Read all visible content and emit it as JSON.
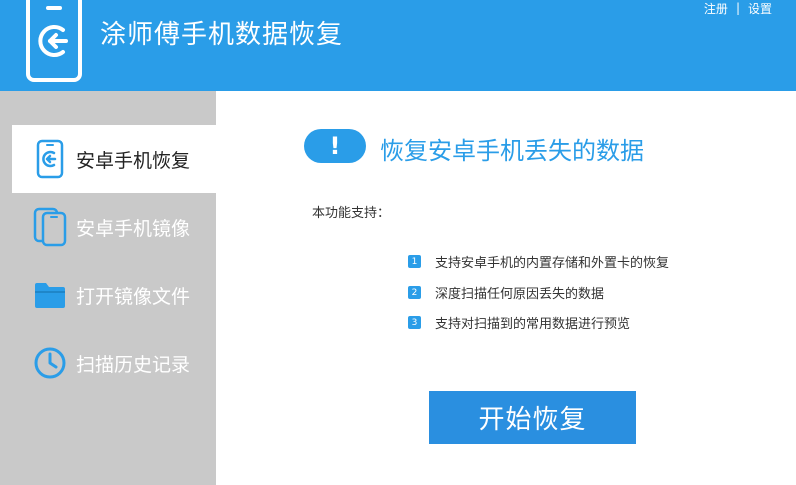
{
  "app": {
    "title": "涂师傅手机数据恢复"
  },
  "top_links": {
    "register": "注册",
    "separator": "|",
    "settings": "设置"
  },
  "sidebar": {
    "items": [
      {
        "label": "安卓手机恢复",
        "icon": "phone-restore-icon",
        "active": true
      },
      {
        "label": "安卓手机镜像",
        "icon": "phone-mirror-icon",
        "active": false
      },
      {
        "label": "打开镜像文件",
        "icon": "folder-icon",
        "active": false
      },
      {
        "label": "扫描历史记录",
        "icon": "clock-icon",
        "active": false
      }
    ]
  },
  "main": {
    "heading_icon": "!",
    "heading": "恢复安卓手机丢失的数据",
    "support_label": "本功能支持：",
    "features": [
      {
        "num": "1",
        "text": "支持安卓手机的内置存储和外置卡的恢复"
      },
      {
        "num": "2",
        "text": "深度扫描任何原因丢失的数据"
      },
      {
        "num": "3",
        "text": "支持对扫描到的常用数据进行预览"
      }
    ],
    "start_button": "开始恢复"
  },
  "colors": {
    "accent": "#2a9de8",
    "sidebar_bg": "#c9c9c9",
    "button": "#2a8fe0"
  }
}
